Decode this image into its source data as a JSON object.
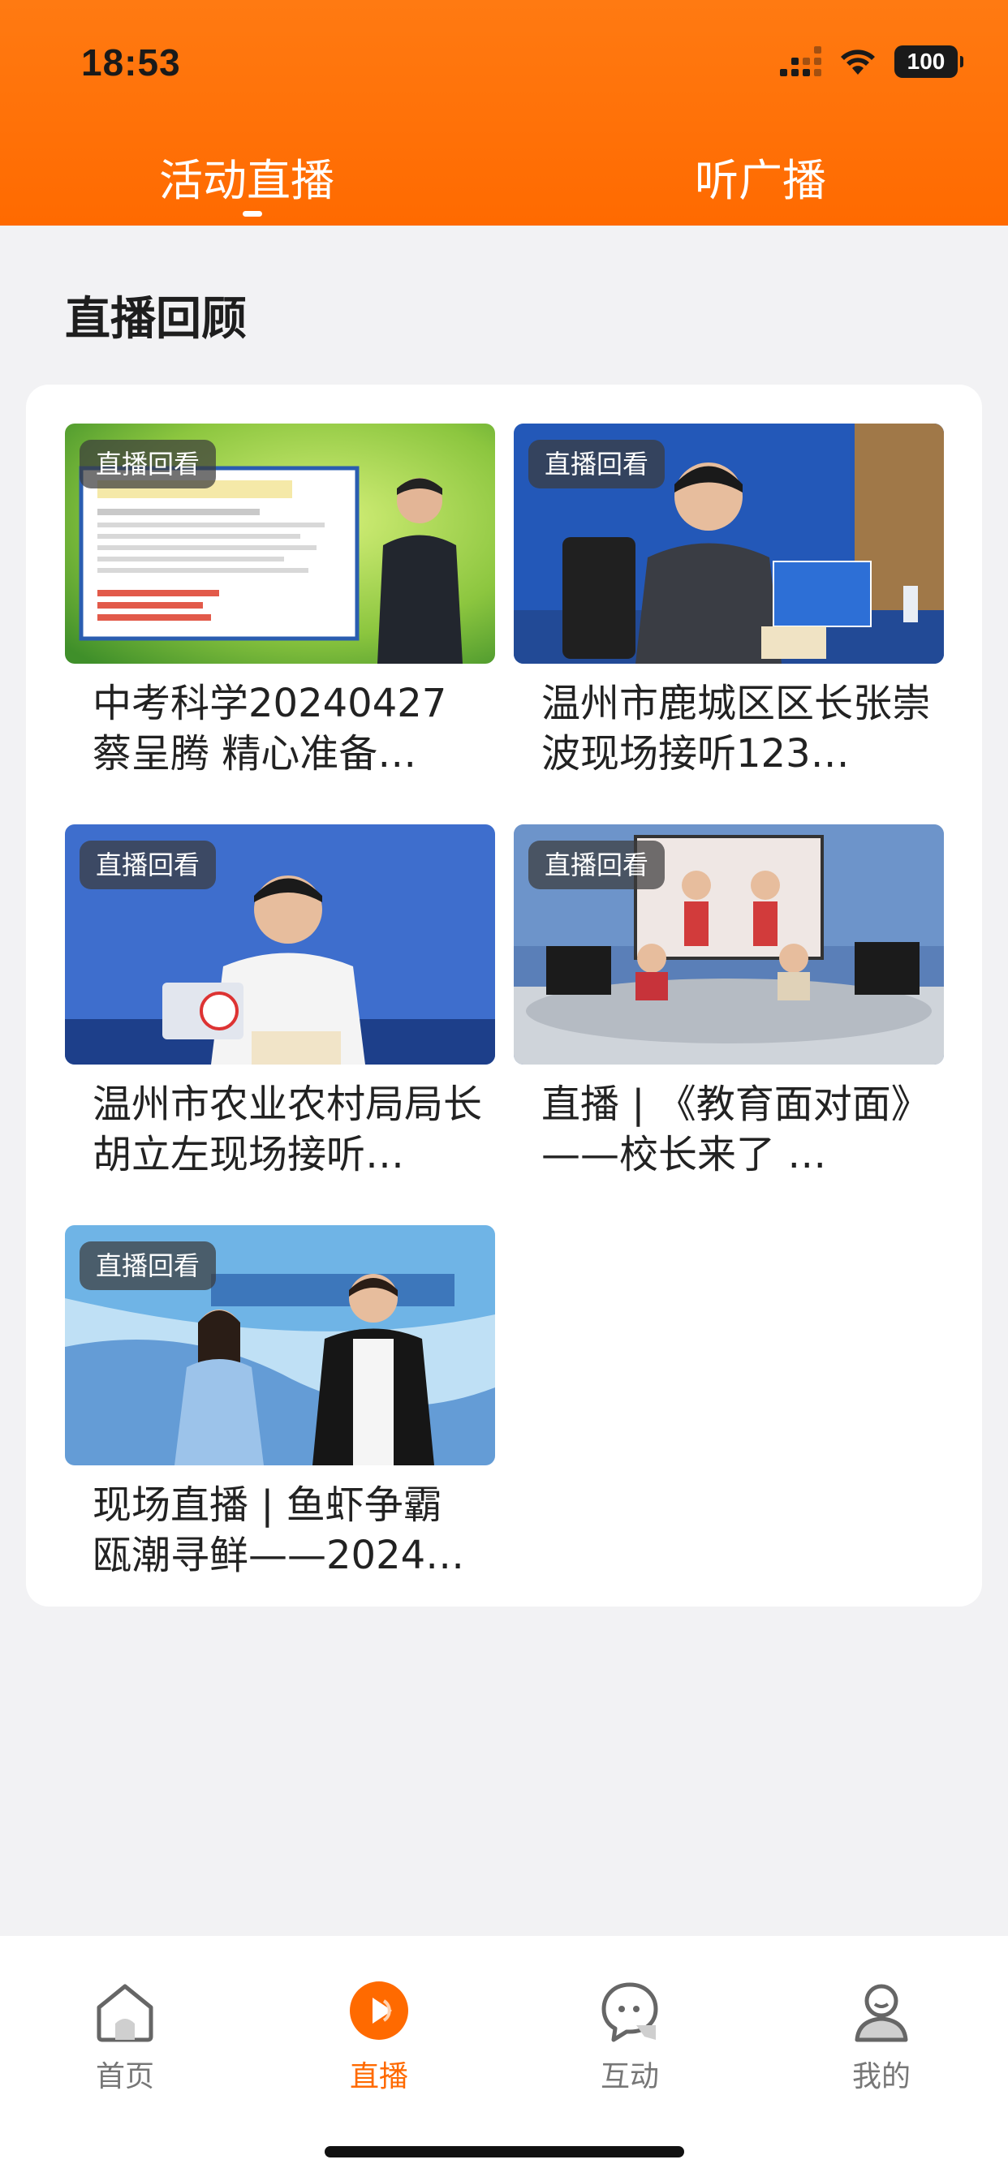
{
  "status_bar": {
    "time": "18:53",
    "battery": "100"
  },
  "top_tabs": [
    {
      "label": "活动直播",
      "active": true
    },
    {
      "label": "听广播",
      "active": false
    }
  ],
  "section": {
    "title": "直播回顾"
  },
  "videos": [
    {
      "badge": "直播回看",
      "title": "中考科学20240427 蔡呈腾 精心准备…"
    },
    {
      "badge": "直播回看",
      "title": "温州市鹿城区区长张崇波现场接听123…"
    },
    {
      "badge": "直播回看",
      "title": "温州市农业农村局局长胡立左现场接听…"
    },
    {
      "badge": "直播回看",
      "title": "直播 | 《教育面对面》——校长来了 …"
    },
    {
      "badge": "直播回看",
      "title": "现场直播 | 鱼虾争霸 瓯潮寻鲜——2024…"
    }
  ],
  "bottom_nav": [
    {
      "label": "首页",
      "icon": "home-icon",
      "active": false
    },
    {
      "label": "直播",
      "icon": "live-play-icon",
      "active": true
    },
    {
      "label": "互动",
      "icon": "chat-icon",
      "active": false
    },
    {
      "label": "我的",
      "icon": "profile-icon",
      "active": false
    }
  ],
  "colors": {
    "brand": "#ff6a00",
    "badge_bg": "#3c3c3c",
    "background": "#f2f2f4"
  }
}
